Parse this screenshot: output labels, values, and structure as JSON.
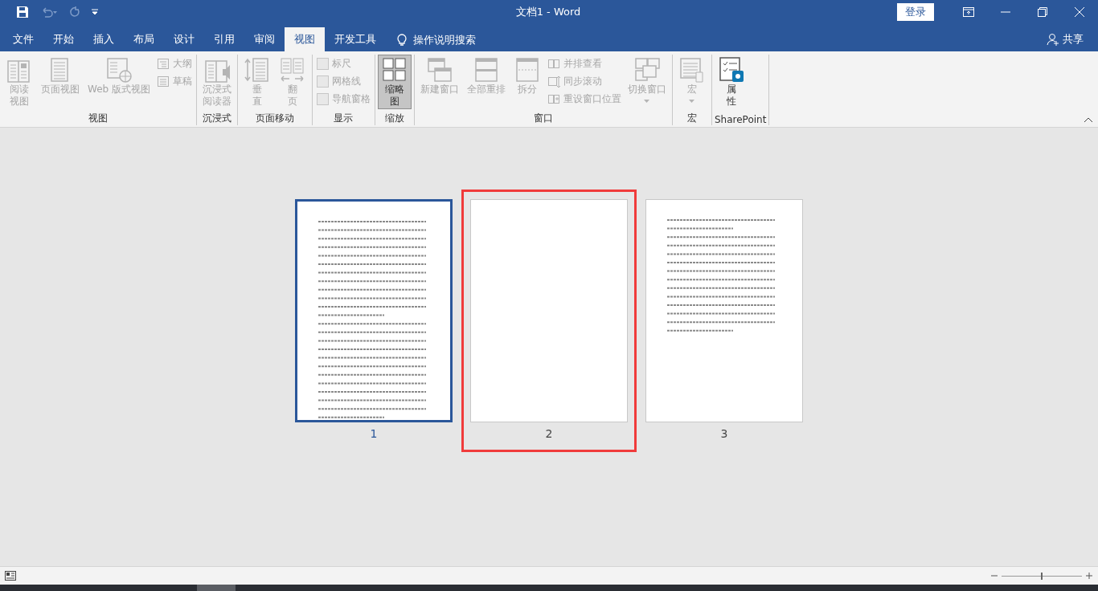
{
  "window": {
    "title": "文档1  -  Word",
    "login_button": "登录"
  },
  "tabs": [
    {
      "label": "文件",
      "selected": false
    },
    {
      "label": "开始",
      "selected": false
    },
    {
      "label": "插入",
      "selected": false
    },
    {
      "label": "布局",
      "selected": false
    },
    {
      "label": "设计",
      "selected": false
    },
    {
      "label": "引用",
      "selected": false
    },
    {
      "label": "审阅",
      "selected": false
    },
    {
      "label": "视图",
      "selected": true
    },
    {
      "label": "开发工具",
      "selected": false
    }
  ],
  "search": {
    "placeholder": "操作说明搜索"
  },
  "share_button": "共享",
  "ribbon": {
    "groups": [
      {
        "label": "视图",
        "items": [
          {
            "kind": "large_two_line",
            "label": "阅读视图",
            "disabled": true
          },
          {
            "kind": "large",
            "label": "页面视图",
            "disabled": true
          },
          {
            "kind": "large",
            "label": "Web 版式视图",
            "disabled": true
          },
          {
            "kind": "stack",
            "items": [
              {
                "kind": "small",
                "label": "大纲",
                "disabled": true
              },
              {
                "kind": "small",
                "label": "草稿",
                "disabled": true
              }
            ]
          }
        ]
      },
      {
        "label": "沉浸式",
        "items": [
          {
            "kind": "large_two_line",
            "label": "沉浸式阅读器",
            "disabled": true
          }
        ]
      },
      {
        "label": "页面移动",
        "items": [
          {
            "kind": "large_two_line",
            "label": "垂直",
            "disabled": true
          },
          {
            "kind": "large_two_line",
            "label": "翻页",
            "disabled": true
          }
        ]
      },
      {
        "label": "显示",
        "items": [
          {
            "kind": "stack",
            "items": [
              {
                "kind": "checkbox",
                "label": "标尺",
                "checked": false,
                "disabled": true
              },
              {
                "kind": "checkbox",
                "label": "网格线",
                "checked": false,
                "disabled": true
              },
              {
                "kind": "checkbox",
                "label": "导航窗格",
                "checked": false,
                "disabled": true
              }
            ]
          }
        ]
      },
      {
        "label": "缩放",
        "items": [
          {
            "kind": "large_two_line",
            "label": "缩略图",
            "disabled": false,
            "selected": true
          }
        ]
      },
      {
        "label": "窗口",
        "items": [
          {
            "kind": "large",
            "label": "新建窗口",
            "disabled": true
          },
          {
            "kind": "large",
            "label": "全部重排",
            "disabled": true
          },
          {
            "kind": "large",
            "label": "拆分",
            "disabled": true
          },
          {
            "kind": "stack",
            "items": [
              {
                "kind": "small",
                "label": "并排查看",
                "disabled": true
              },
              {
                "kind": "small",
                "label": "同步滚动",
                "disabled": true
              },
              {
                "kind": "small",
                "label": "重设窗口位置",
                "disabled": true
              }
            ]
          },
          {
            "kind": "dropdown",
            "label": "切换窗口",
            "disabled": true
          }
        ]
      },
      {
        "label": "宏",
        "items": [
          {
            "kind": "dropdown",
            "label": "宏",
            "disabled": true
          }
        ]
      },
      {
        "label": "SharePoint",
        "items": [
          {
            "kind": "large_two_line",
            "label": "属性",
            "disabled": false
          }
        ]
      }
    ]
  },
  "pages": [
    {
      "number": "1",
      "kind": "full",
      "selected": true,
      "highlighted": false
    },
    {
      "number": "2",
      "kind": "blank",
      "selected": false,
      "highlighted": true
    },
    {
      "number": "3",
      "kind": "partial",
      "selected": false,
      "highlighted": false
    }
  ],
  "status_bar": {
    "zoom": {
      "level": 0.5
    }
  }
}
